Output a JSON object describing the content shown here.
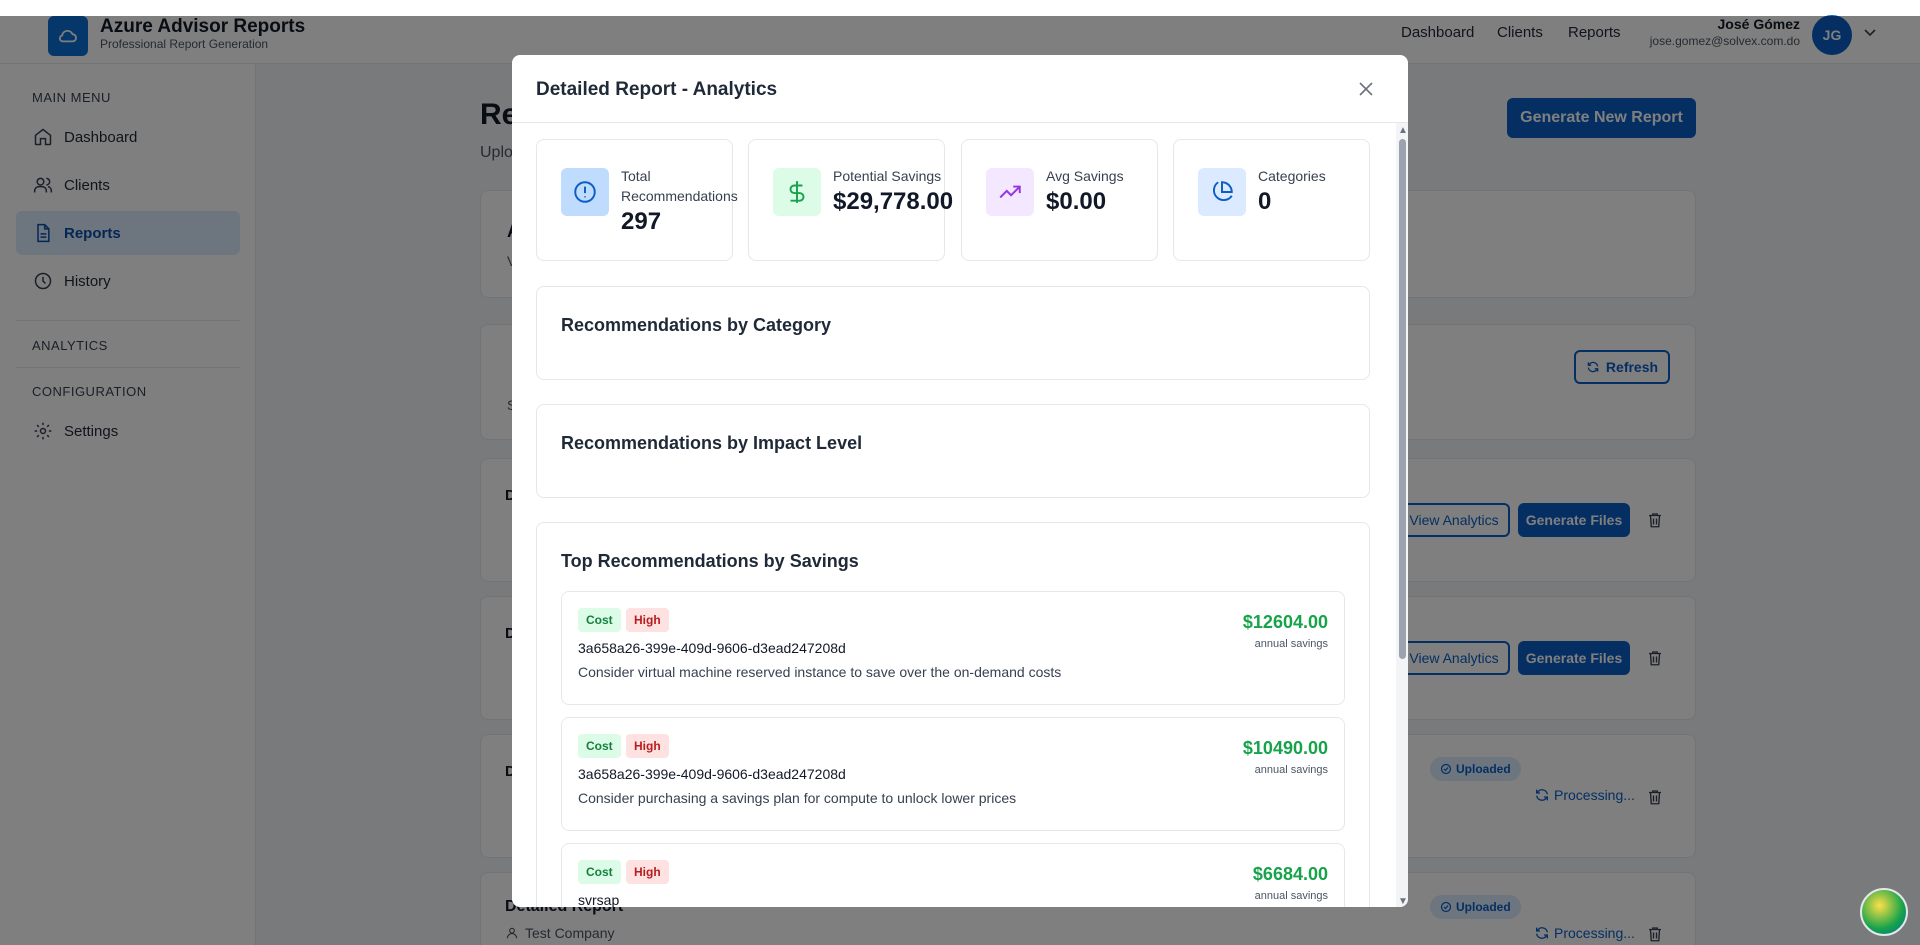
{
  "app": {
    "title": "Azure Advisor Reports",
    "subtitle": "Professional Report Generation"
  },
  "header_nav": [
    "Dashboard",
    "Clients",
    "Reports"
  ],
  "user": {
    "name": "José Gómez",
    "email": "jose.gomez@solvex.com.do",
    "initials": "JG"
  },
  "sidebar": {
    "main_menu_label": "MAIN MENU",
    "items": [
      {
        "label": "Dashboard",
        "icon": "home-icon"
      },
      {
        "label": "Clients",
        "icon": "users-icon"
      },
      {
        "label": "Reports",
        "icon": "file-icon",
        "active": true
      },
      {
        "label": "History",
        "icon": "clock-icon"
      }
    ],
    "analytics_label": "ANALYTICS",
    "configuration_label": "CONFIGURATION",
    "settings_label": "Settings"
  },
  "background": {
    "page_title_fragment": "Re",
    "page_sub_fragment": "Uplo",
    "generate_button": "Generate New Report",
    "refresh_button": "Refresh",
    "view_analytics": "View Analytics",
    "generate_files": "Generate Files",
    "uploaded": "Uploaded",
    "processing": "Processing...",
    "report_title": "Detailed Report",
    "report_client": "Test Company",
    "fragments": {
      "a": "A",
      "v": "V",
      "s": "S",
      "d": "D"
    }
  },
  "modal": {
    "title": "Detailed Report - Analytics",
    "stats": [
      {
        "label": "Total Recommendations",
        "value": "297",
        "icon": "alert-circle-icon",
        "color": "#0b5ec4"
      },
      {
        "label": "Potential Savings",
        "value": "$29,778.00",
        "icon": "dollar-icon",
        "color": "#16a34a"
      },
      {
        "label": "Avg Savings",
        "value": "$0.00",
        "icon": "trending-up-icon",
        "color": "#9333ea"
      },
      {
        "label": "Categories",
        "value": "0",
        "icon": "pie-chart-icon",
        "color": "#0b5ec4"
      }
    ],
    "sections": {
      "by_category": "Recommendations by Category",
      "by_impact": "Recommendations by Impact Level",
      "top_savings": "Top Recommendations by Savings"
    },
    "recommendations": [
      {
        "category": "Cost",
        "impact": "High",
        "resource": "3a658a26-399e-409d-9606-d3ead247208d",
        "description": "Consider virtual machine reserved instance to save over the on-demand costs",
        "amount": "$12604.00",
        "amount_label": "annual savings"
      },
      {
        "category": "Cost",
        "impact": "High",
        "resource": "3a658a26-399e-409d-9606-d3ead247208d",
        "description": "Consider purchasing a savings plan for compute to unlock lower prices",
        "amount": "$10490.00",
        "amount_label": "annual savings"
      },
      {
        "category": "Cost",
        "impact": "High",
        "resource": "svrsap",
        "description": "",
        "amount": "$6684.00",
        "amount_label": "annual savings"
      }
    ]
  }
}
